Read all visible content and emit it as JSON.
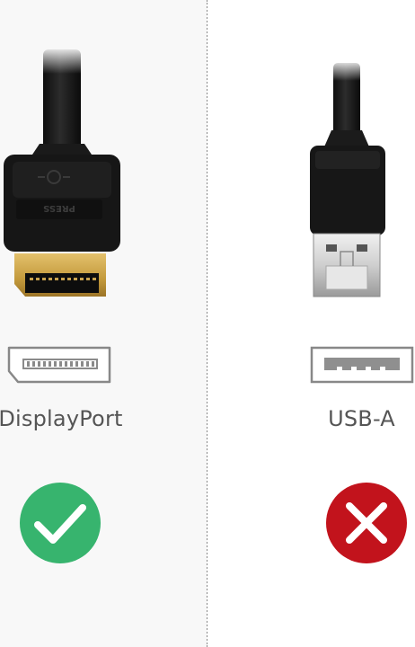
{
  "colors": {
    "cable": "#151515",
    "gold": "#c9a04a",
    "metal": "#d8d8d8",
    "check": "#37b46e",
    "cross": "#c2131c",
    "label": "#555555"
  },
  "connectors": [
    {
      "label": "DisplayPort",
      "plug_text": "PRESS",
      "port_icon": "displayport-port-icon",
      "status_icon": "check-icon",
      "compatible": true
    },
    {
      "label": "USB-A",
      "port_icon": "usb-a-port-icon",
      "status_icon": "cross-icon",
      "compatible": false
    }
  ]
}
